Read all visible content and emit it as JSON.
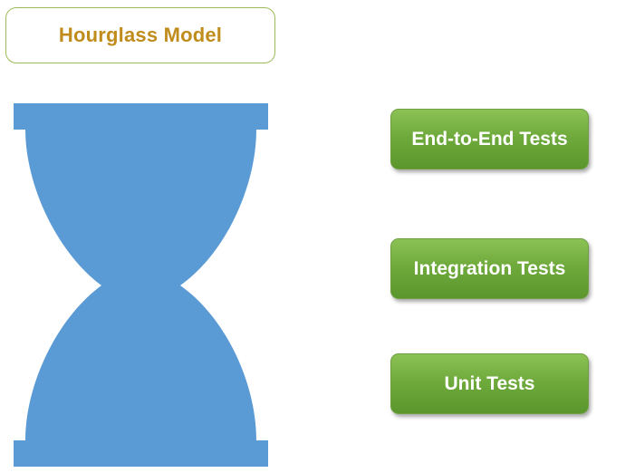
{
  "title": "Hourglass Model",
  "colors": {
    "title_text": "#c08c1c",
    "title_border": "#9bbb59",
    "hourglass_fill": "#5b9bd5",
    "box_fill": "#72ad3f",
    "box_text": "#ffffff"
  },
  "test_levels": [
    {
      "label": "End-to-End Tests"
    },
    {
      "label": "Integration Tests"
    },
    {
      "label": "Unit Tests"
    }
  ]
}
